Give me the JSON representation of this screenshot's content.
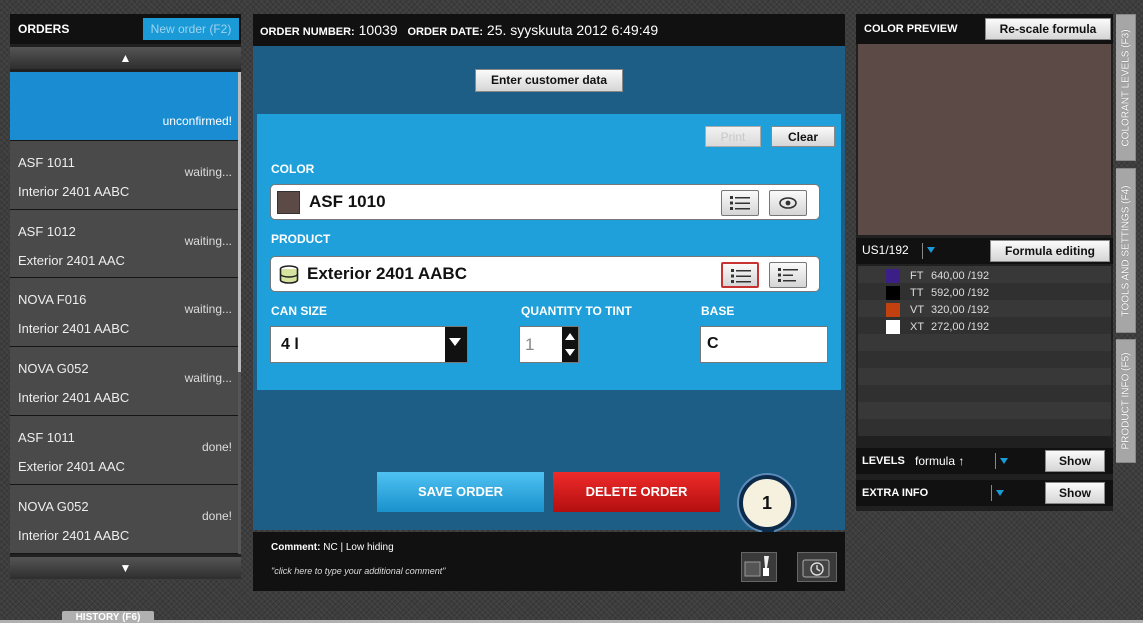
{
  "orders": {
    "title": "ORDERS",
    "new_order_label": "New order (F2)",
    "items": [
      {
        "code": "",
        "product": "",
        "status": "unconfirmed!"
      },
      {
        "code": "ASF 1011",
        "product": "Interior 2401 AABC",
        "status": "waiting..."
      },
      {
        "code": "ASF 1012",
        "product": "Exterior 2401 AAC",
        "status": "waiting..."
      },
      {
        "code": "NOVA F016",
        "product": "Interior 2401 AABC",
        "status": "waiting..."
      },
      {
        "code": "NOVA G052",
        "product": "Interior 2401 AABC",
        "status": "waiting..."
      },
      {
        "code": "ASF 1011",
        "product": "Exterior 2401 AAC",
        "status": "done!"
      },
      {
        "code": "NOVA G052",
        "product": "Interior 2401 AABC",
        "status": "done!"
      }
    ]
  },
  "order": {
    "number_label": "ORDER NUMBER:",
    "number": "10039",
    "date_label": "ORDER DATE:",
    "date": "25. syyskuuta 2012 6:49:49",
    "customer_button": "Enter customer data",
    "print_button": "Print",
    "clear_button": "Clear",
    "color_label": "COLOR",
    "color_value": "ASF 1010",
    "product_label": "PRODUCT",
    "product_value": "Exterior 2401 AABC",
    "can_size_label": "CAN SIZE",
    "can_size_value": "4 l",
    "quantity_label": "QUANTITY TO TINT",
    "quantity_value": "1",
    "base_label": "BASE",
    "base_value": "C",
    "save_button": "SAVE ORDER",
    "delete_button": "DELETE ORDER",
    "step_badge": "1"
  },
  "comment": {
    "label": "Comment:",
    "value": "NC | Low hiding",
    "placeholder": "\"click here to type your additional comment\""
  },
  "preview": {
    "title": "COLOR PREVIEW",
    "rescale_button": "Re-scale formula",
    "formula_unit": "US1/192",
    "formula_editing_button": "Formula editing",
    "colorants": [
      {
        "name": "FT",
        "amount": "640,00 /192",
        "color": "#3c1f86"
      },
      {
        "name": "TT",
        "amount": "592,00 /192",
        "color": "#000000"
      },
      {
        "name": "VT",
        "amount": "320,00 /192",
        "color": "#c2410f"
      },
      {
        "name": "XT",
        "amount": "272,00 /192",
        "color": "#ffffff"
      }
    ],
    "levels_label": "LEVELS",
    "levels_value": "formula ↑",
    "levels_show": "Show",
    "extra_label": "EXTRA INFO",
    "extra_show": "Show"
  },
  "side_tabs": {
    "colorant_levels": "COLORANT LEVELS (F3)",
    "tools_settings": "TOOLS AND SETTINGS (F4)",
    "product_info": "PRODUCT INFO (F5)"
  },
  "history_tab": "HISTORY (F6)",
  "colors": {
    "accent": "#1a9ad6",
    "panel_blue": "#1d5e86",
    "preview_color": "#5c4a47",
    "save": "#1991cc",
    "delete": "#c91515"
  }
}
